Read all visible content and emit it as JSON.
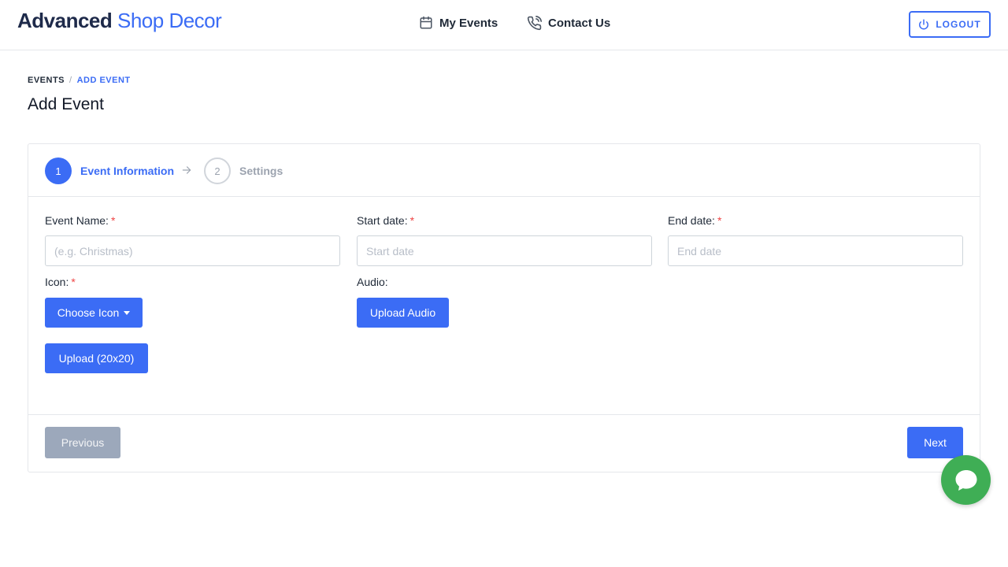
{
  "header": {
    "brand_primary": "Advanced",
    "brand_secondary": "Shop Decor",
    "nav": [
      {
        "label": "My Events",
        "icon": "calendar-icon"
      },
      {
        "label": "Contact Us",
        "icon": "phone-icon"
      }
    ],
    "logout_label": "LOGOUT",
    "logout_icon": "power-icon"
  },
  "breadcrumb": {
    "root": "EVENTS",
    "separator": "/",
    "current": "ADD EVENT"
  },
  "page_title": "Add Event",
  "wizard": {
    "steps": [
      {
        "number": "1",
        "label": "Event Information",
        "active": true
      },
      {
        "number": "2",
        "label": "Settings",
        "active": false
      }
    ]
  },
  "form": {
    "required_mark": "*",
    "event_name": {
      "label": "Event Name:",
      "placeholder": "(e.g. Christmas)",
      "value": ""
    },
    "start_date": {
      "label": "Start date:",
      "placeholder": "Start date",
      "value": ""
    },
    "end_date": {
      "label": "End date:",
      "placeholder": "End date",
      "value": ""
    },
    "icon": {
      "label": "Icon:",
      "choose_label": "Choose Icon",
      "upload_label": "Upload (20x20)"
    },
    "audio": {
      "label": "Audio:",
      "upload_label": "Upload Audio"
    }
  },
  "footer": {
    "previous_label": "Previous",
    "next_label": "Next"
  },
  "colors": {
    "accent": "#3b6cf5",
    "brand_dark": "#1e2a4a",
    "required": "#ef4444",
    "disabled_button": "#9ca8bb",
    "chat": "#3fae55"
  }
}
